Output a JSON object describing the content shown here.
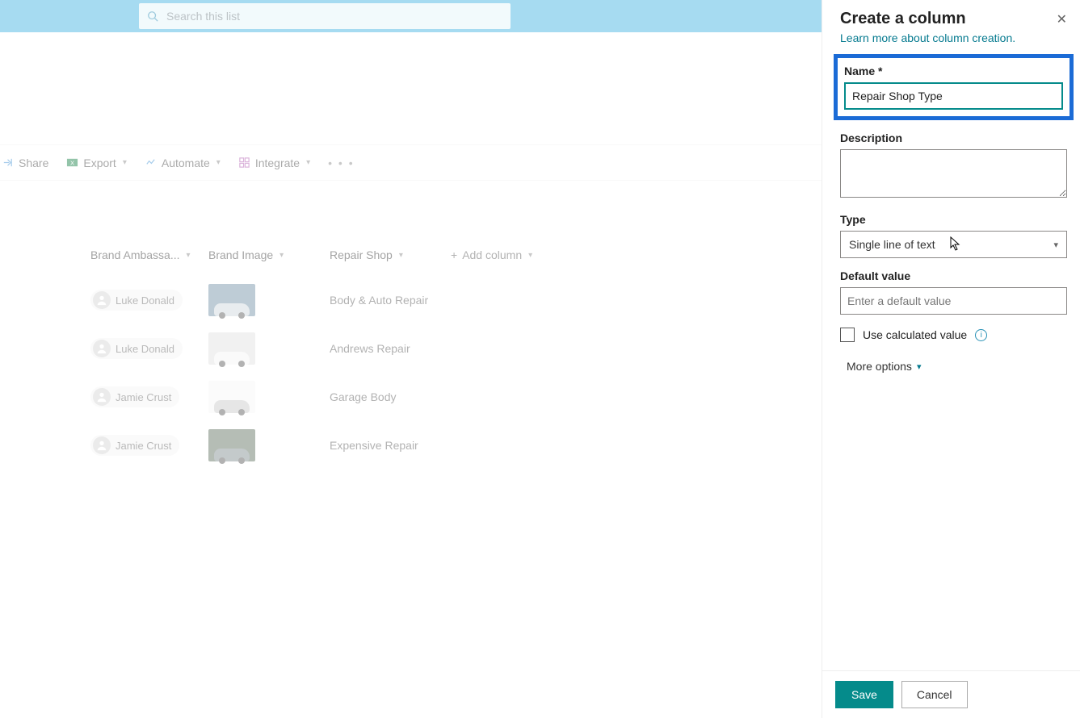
{
  "search": {
    "placeholder": "Search this list"
  },
  "toolbar": {
    "share": "Share",
    "export": "Export",
    "automate": "Automate",
    "integrate": "Integrate"
  },
  "columns": {
    "ambassador": "Brand Ambassa...",
    "image": "Brand Image",
    "repair": "Repair Shop",
    "add": "Add column"
  },
  "rows": [
    {
      "ambassador": "Luke Donald",
      "repair": "Body & Auto Repair",
      "thumbBg": "#6f8fa5",
      "carColor": "#cdd6db"
    },
    {
      "ambassador": "Luke Donald",
      "repair": "Andrews Repair",
      "thumbBg": "#e1e1e1",
      "carColor": "#f3f3f3"
    },
    {
      "ambassador": "Jamie Crust",
      "repair": "Garage Body",
      "thumbBg": "#f5f5f5",
      "carColor": "#c8c8c8"
    },
    {
      "ambassador": "Jamie Crust",
      "repair": "Expensive Repair",
      "thumbBg": "#5b6e5c",
      "carColor": "#7d8b8d"
    }
  ],
  "panel": {
    "title": "Create a column",
    "learn": "Learn more about column creation.",
    "name_label": "Name *",
    "name_value": "Repair Shop Type",
    "desc_label": "Description",
    "type_label": "Type",
    "type_value": "Single line of text",
    "default_label": "Default value",
    "default_placeholder": "Enter a default value",
    "calc_label": "Use calculated value",
    "more": "More options",
    "save": "Save",
    "cancel": "Cancel"
  }
}
